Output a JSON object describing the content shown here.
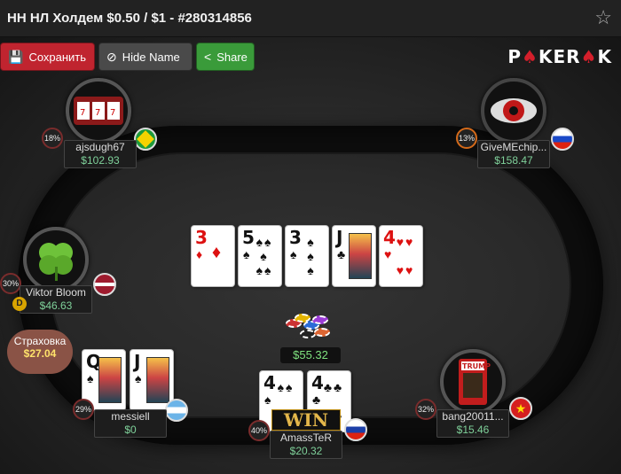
{
  "window": {
    "title": "НН НЛ Холдем $0.50 / $1 - #280314856",
    "favorite_icon": "star-icon"
  },
  "toolbar": {
    "save_label": "Сохранить",
    "hide_name_label": "Hide Name",
    "share_label": "Share",
    "save_icon": "floppy-icon",
    "hide_icon": "eye-slash-icon",
    "share_icon": "share-icon"
  },
  "brand": {
    "logo_text": "POKEROK",
    "accent": "#d41f2b"
  },
  "board": {
    "cards": [
      {
        "rank": "3",
        "suit": "♦",
        "color": "red"
      },
      {
        "rank": "5",
        "suit": "♠",
        "color": "black"
      },
      {
        "rank": "3",
        "suit": "♠",
        "color": "black"
      },
      {
        "rank": "J",
        "suit": "♣",
        "color": "black"
      },
      {
        "rank": "4",
        "suit": "♥",
        "color": "red"
      }
    ]
  },
  "pot": {
    "amount": "$55.32"
  },
  "insurance": {
    "label": "Страховка",
    "amount": "$27.04"
  },
  "players": [
    {
      "id": "top-left",
      "name": "ajsdugh67",
      "stack": "$102.93",
      "pct": "18%",
      "flag": "brazil"
    },
    {
      "id": "top-right",
      "name": "GiveMEchip...",
      "stack": "$158.47",
      "pct": "13%",
      "flag": "slovenia"
    },
    {
      "id": "left",
      "name": "Viktor Bloom",
      "stack": "$46.63",
      "pct": "30%",
      "flag": "latvia",
      "dealer": "D"
    },
    {
      "id": "bottom-left",
      "name": "messiell",
      "stack": "$0",
      "pct": "29%",
      "flag": "argentina",
      "hole_cards": [
        {
          "rank": "Q",
          "suit": "♠"
        },
        {
          "rank": "J",
          "suit": "♠"
        }
      ]
    },
    {
      "id": "hero",
      "name": "AmassTeR",
      "stack": "$20.32",
      "pct": "40%",
      "flag": "russia",
      "badge": "WIN",
      "hole_cards": [
        {
          "rank": "4",
          "suit": "♠"
        },
        {
          "rank": "4",
          "suit": "♣"
        }
      ]
    },
    {
      "id": "bottom-right",
      "name": "bang20011...",
      "stack": "$15.46",
      "pct": "32%",
      "flag": "vietnam"
    }
  ]
}
